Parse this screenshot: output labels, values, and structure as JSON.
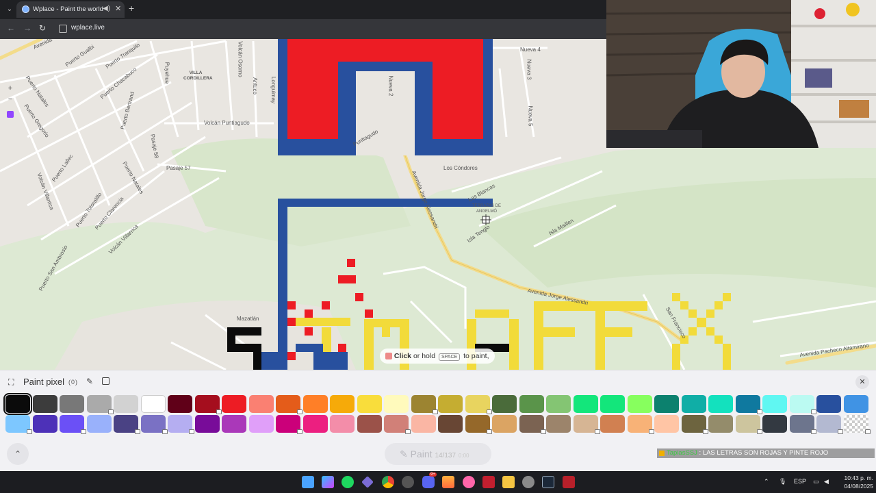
{
  "browser": {
    "tab_title": "Wplace - Paint the world",
    "address": "wplace.live",
    "tab_close_glyph": "✕",
    "new_tab_glyph": "+",
    "back_glyph": "←",
    "forward_glyph": "→",
    "reload_glyph": "↻"
  },
  "map": {
    "labels": [
      "Avenida",
      "Puerto Gualbi",
      "Puerto Tranquilo",
      "Puerto Natales",
      "Puerto Chacabuco",
      "Puerto Gregorio",
      "Puerto Bertrand",
      "Volcán Osorno",
      "Puyehue",
      "Volcán Puntiagudo",
      "Pasaje 58",
      "Pasaje 57",
      "Antuco",
      "VILLA CORDILLERA",
      "Puerto Natales",
      "Puerto Lailec",
      "Volcán Villarrica",
      "Puerto Totoralillo",
      "Puerto Clarencia",
      "Volcán Villarrica",
      "Puerto San Ambrosio",
      "Mazatlán",
      "Nueva 4",
      "Nueva 3",
      "Nueva 5",
      "Los Cóndores",
      "Puntiagudo",
      "Avenida Jorge Alessandri",
      "Las Blancas",
      "TERRAZAS DE ANGELMÓ",
      "Isla Tenglo",
      "Isla Maillen",
      "Avenida Jorge Alessandri",
      "San Francisco",
      "Avenida Pacheco Altamirano",
      "Longuimay",
      "Nueva 2"
    ],
    "paint_hint": {
      "click": "Click",
      "or_hold": "or hold",
      "key": "SPACE",
      "to_paint": "to paint,"
    }
  },
  "panel": {
    "title": "Paint pixel",
    "count": "(0)",
    "paint_label": "Paint",
    "charges": "14/137",
    "timer": "0:00",
    "expand_glyph": "⛶",
    "pencil_glyph": "✎",
    "close_glyph": "✕",
    "collapse_glyph": "⌃"
  },
  "palette": {
    "row1": [
      "#0b0b0b",
      "#3c3c3c",
      "#787878",
      "#aaaaaa",
      "#d2d2d2",
      "#ffffff",
      "#600018",
      "#a50e1e",
      "#ed1c24",
      "#fa8072",
      "#e45c1a",
      "#ff7f27",
      "#f6aa09",
      "#f9dd3b",
      "#fffabc",
      "#9c8431",
      "#c5ad31",
      "#e8d45f",
      "#4a6b3a",
      "#5a944a",
      "#84c573",
      "#13e67b",
      "#13e67b",
      "#87ff5e",
      "#0c816e",
      "#10aea6",
      "#13e1be",
      "#0f799f",
      "#60f7f2",
      "#bbfaf2",
      "#28509e",
      "#4093e4"
    ],
    "row2": [
      "#7dc7ff",
      "#4d31b8",
      "#6b50f6",
      "#99b1fb",
      "#4a4284",
      "#7a71c4",
      "#b5aef1",
      "#780c99",
      "#aa38b9",
      "#e09ff9",
      "#cb007a",
      "#ec1f80",
      "#f38da9",
      "#9b5249",
      "#d18078",
      "#fab6a4",
      "#684634",
      "#95682a",
      "#dba463",
      "#7b6352",
      "#9c846b",
      "#d6b594",
      "#d18051",
      "#f8b277",
      "#ffc5a5",
      "#6d643f",
      "#948c6b",
      "#cdc59e",
      "#333941",
      "#6d758d",
      "#b3b9d1",
      "#checker"
    ],
    "row1_locked": [
      false,
      false,
      false,
      true,
      false,
      false,
      false,
      true,
      false,
      false,
      true,
      false,
      false,
      false,
      false,
      true,
      false,
      true,
      false,
      false,
      false,
      false,
      false,
      false,
      false,
      false,
      false,
      true,
      false,
      true,
      false,
      false
    ],
    "row2_locked": [
      true,
      false,
      true,
      false,
      true,
      true,
      true,
      false,
      false,
      false,
      true,
      false,
      false,
      false,
      true,
      false,
      false,
      true,
      false,
      true,
      false,
      true,
      false,
      true,
      false,
      true,
      false,
      true,
      false,
      true,
      true,
      true
    ],
    "selected": "#0b0b0b"
  },
  "chat": {
    "user": "TapiasSSJ",
    "separator": ":",
    "message": "LAS LETRAS SON ROJAS Y PINTE ROJO"
  },
  "taskbar": {
    "apps": [
      "windows-start",
      "copilot",
      "spotify",
      "git",
      "chrome",
      "obs",
      "discord",
      "clipchamp",
      "osu",
      "hp-omen",
      "file-explorer",
      "settings",
      "steam",
      "dzl"
    ],
    "discord_badge": "9+",
    "lang": "ESP",
    "time": "10:43 p. m.",
    "date": "04/08/2025"
  }
}
